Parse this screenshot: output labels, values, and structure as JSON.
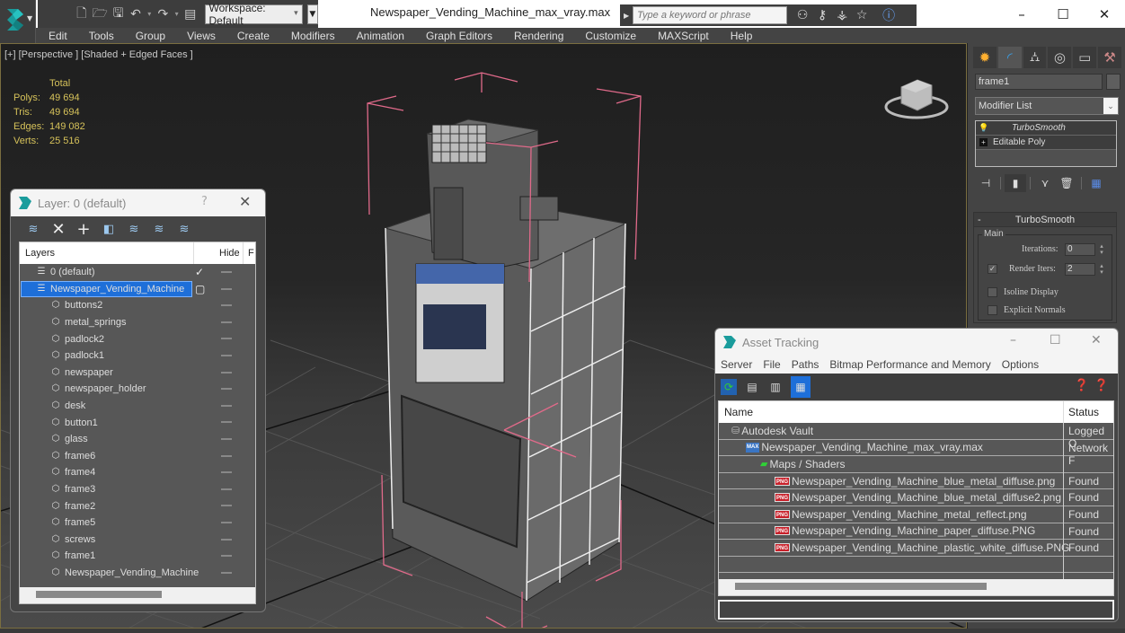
{
  "titlebar": {
    "workspace_label": "Workspace: Default",
    "document_title": "Newspaper_Vending_Machine_max_vray.max",
    "search_placeholder": "Type a keyword or phrase",
    "icons": [
      "app-logo-icon",
      "new-file-icon",
      "open-file-icon",
      "save-icon",
      "undo-icon",
      "redo-icon",
      "project-folder-icon",
      "binoculars-icon",
      "key-icon",
      "exchange-icon",
      "star-icon",
      "help-icon"
    ],
    "window_controls": {
      "minimize": "–",
      "maximize": "☐",
      "close": "✕"
    }
  },
  "menubar": {
    "items": [
      "Edit",
      "Tools",
      "Group",
      "Views",
      "Create",
      "Modifiers",
      "Animation",
      "Graph Editors",
      "Rendering",
      "Customize",
      "MAXScript",
      "Help"
    ]
  },
  "viewport": {
    "label": "[+] [Perspective ] [Shaded + Edged Faces ]",
    "stats": {
      "header": "Total",
      "rows": [
        {
          "key": "Polys:",
          "value": "49 694"
        },
        {
          "key": "Tris:",
          "value": "49 694"
        },
        {
          "key": "Edges:",
          "value": "149 082"
        },
        {
          "key": "Verts:",
          "value": "25 516"
        }
      ]
    },
    "colors": {
      "selection_bracket": "#e06a8a",
      "stats_text": "#d6c25a"
    }
  },
  "command_panel": {
    "tabs": [
      "create-tab",
      "modify-tab",
      "hierarchy-tab",
      "motion-tab",
      "display-tab",
      "utilities-tab"
    ],
    "object_name": "frame1",
    "modifier_list_label": "Modifier List",
    "stack": [
      {
        "label": "TurboSmooth",
        "icon": "lightbulb-icon"
      },
      {
        "label": "Editable Poly",
        "icon": "expand-plus-icon"
      }
    ],
    "rollout": {
      "title": "TurboSmooth",
      "group": "Main",
      "iterations_label": "Iterations:",
      "iterations_value": "0",
      "render_iters_label": "Render Iters:",
      "render_iters_value": "2",
      "render_iters_checked": true,
      "isoline_label": "Isoline Display",
      "isoline_checked": false,
      "explicit_normals_label": "Explicit Normals",
      "explicit_normals_checked": false
    }
  },
  "layer_dialog": {
    "title": "Layer: 0 (default)",
    "help": "?",
    "close": "✕",
    "columns": {
      "layers": "Layers",
      "hide": "Hide",
      "freeze": "F"
    },
    "rows": [
      {
        "label": "0 (default)",
        "type": "layer",
        "active": true,
        "selected": false
      },
      {
        "label": "Newspaper_Vending_Machine",
        "type": "layer",
        "active": false,
        "selected": true
      },
      {
        "label": "buttons2",
        "type": "object"
      },
      {
        "label": "metal_springs",
        "type": "object"
      },
      {
        "label": "padlock2",
        "type": "object"
      },
      {
        "label": "padlock1",
        "type": "object"
      },
      {
        "label": "newspaper",
        "type": "object"
      },
      {
        "label": "newspaper_holder",
        "type": "object"
      },
      {
        "label": "desk",
        "type": "object"
      },
      {
        "label": "button1",
        "type": "object"
      },
      {
        "label": "glass",
        "type": "object"
      },
      {
        "label": "frame6",
        "type": "object"
      },
      {
        "label": "frame4",
        "type": "object"
      },
      {
        "label": "frame3",
        "type": "object"
      },
      {
        "label": "frame2",
        "type": "object"
      },
      {
        "label": "frame5",
        "type": "object"
      },
      {
        "label": "screws",
        "type": "object"
      },
      {
        "label": "frame1",
        "type": "object"
      },
      {
        "label": "Newspaper_Vending_Machine",
        "type": "object"
      }
    ]
  },
  "asset_dialog": {
    "title": "Asset Tracking",
    "menu": [
      "Server",
      "File",
      "Paths",
      "Bitmap Performance and Memory",
      "Options"
    ],
    "columns": {
      "name": "Name",
      "status": "Status"
    },
    "rows": [
      {
        "name": "Autodesk Vault",
        "status": "Logged O",
        "indent": 1,
        "icon": "vault"
      },
      {
        "name": "Newspaper_Vending_Machine_max_vray.max",
        "status": "Network F",
        "indent": 2,
        "icon": "max"
      },
      {
        "name": "Maps / Shaders",
        "status": "",
        "indent": 3,
        "icon": "maps"
      },
      {
        "name": "Newspaper_Vending_Machine_blue_metal_diffuse.png",
        "status": "Found",
        "indent": 4,
        "icon": "png"
      },
      {
        "name": "Newspaper_Vending_Machine_blue_metal_diffuse2.png",
        "status": "Found",
        "indent": 4,
        "icon": "png"
      },
      {
        "name": "Newspaper_Vending_Machine_metal_reflect.png",
        "status": "Found",
        "indent": 4,
        "icon": "png"
      },
      {
        "name": "Newspaper_Vending_Machine_paper_diffuse.PNG",
        "status": "Found",
        "indent": 4,
        "icon": "png"
      },
      {
        "name": "Newspaper_Vending_Machine_plastic_white_diffuse.PNG",
        "status": "Found",
        "indent": 4,
        "icon": "png"
      }
    ]
  }
}
